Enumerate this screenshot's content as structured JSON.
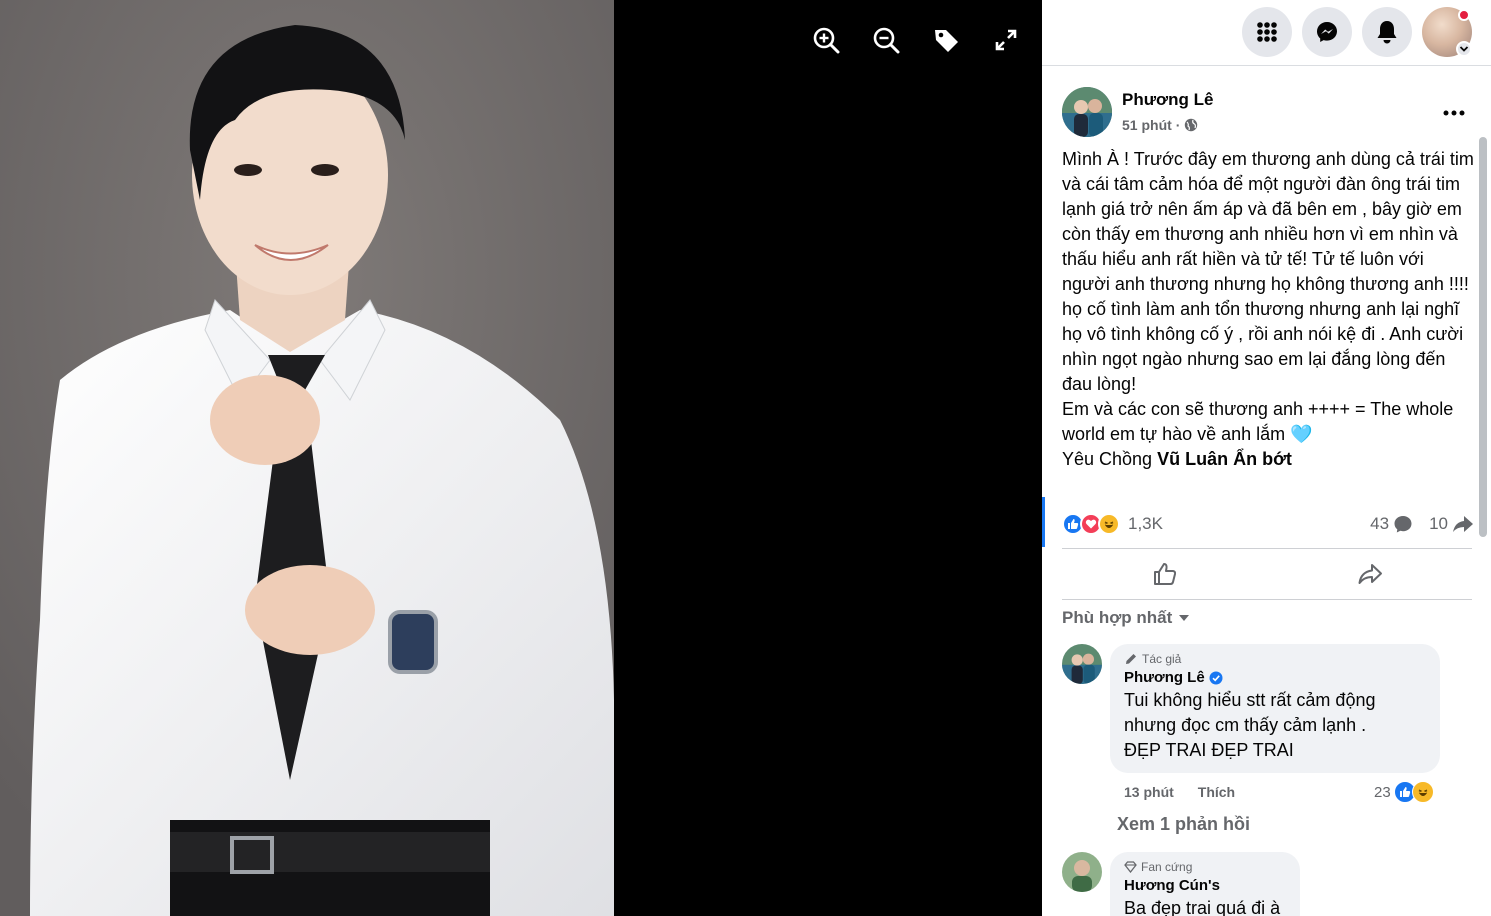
{
  "viewer": {
    "tools": [
      {
        "name": "zoom-in-icon"
      },
      {
        "name": "zoom-out-icon"
      },
      {
        "name": "tag-icon"
      },
      {
        "name": "fullscreen-icon"
      }
    ]
  },
  "topbar": {
    "icons": [
      "menu-grid-icon",
      "messenger-icon",
      "bell-icon"
    ]
  },
  "post": {
    "author": "Phương Lê",
    "time": "51 phút",
    "text": "Mình À ! Trước đây em thương anh dùng cả trái tim và cái tâm cảm hóa để một người đàn ông trái tim lạnh giá trở nên ấm áp và đã bên em , bây giờ em còn thấy em thương anh nhiều hơn vì em nhìn và thấu hiểu anh rất hiền và tử tế! Tử tế luôn với người anh thương nhưng họ không thương anh !!!! họ cố tình làm anh tổn thương nhưng anh lại nghĩ họ vô tình không cố ý , rồi anh nói kệ đi . Anh cười nhìn ngọt ngào nhưng sao em lại đắng lòng đến đau lòng!\nEm và các con sẽ thương anh ++++ = The whole world em tự hào về anh lắm",
    "emoji": "🩵",
    "closing_prefix": "Yêu Chồng ",
    "tagged": "Vũ Luân Ẩn bớt",
    "reaction_count": "1,3K",
    "comment_count": "43",
    "share_count": "10"
  },
  "comments_sort": "Phù hợp nhất",
  "comments": [
    {
      "badge": "Tác giả",
      "name": "Phương Lê",
      "text": "Tui không hiểu stt rất cảm động\nnhưng đọc cm thấy cảm lạnh .\nĐẸP TRAI ĐẸP TRAI",
      "time": "13 phút",
      "like_label": "Thích",
      "reaction_count": "23"
    },
    {
      "badge": "Fan cứng",
      "name": "Hương Cún's",
      "text": "Ba đẹp trai quá đi à"
    }
  ],
  "view_replies": "Xem 1 phản hồi",
  "colors": {
    "accent": "#1877f2",
    "secondary_text": "#65676b",
    "bubble": "#f0f2f5",
    "like": "#1877f2",
    "love": "#f33e58",
    "haha": "#f7b928"
  }
}
